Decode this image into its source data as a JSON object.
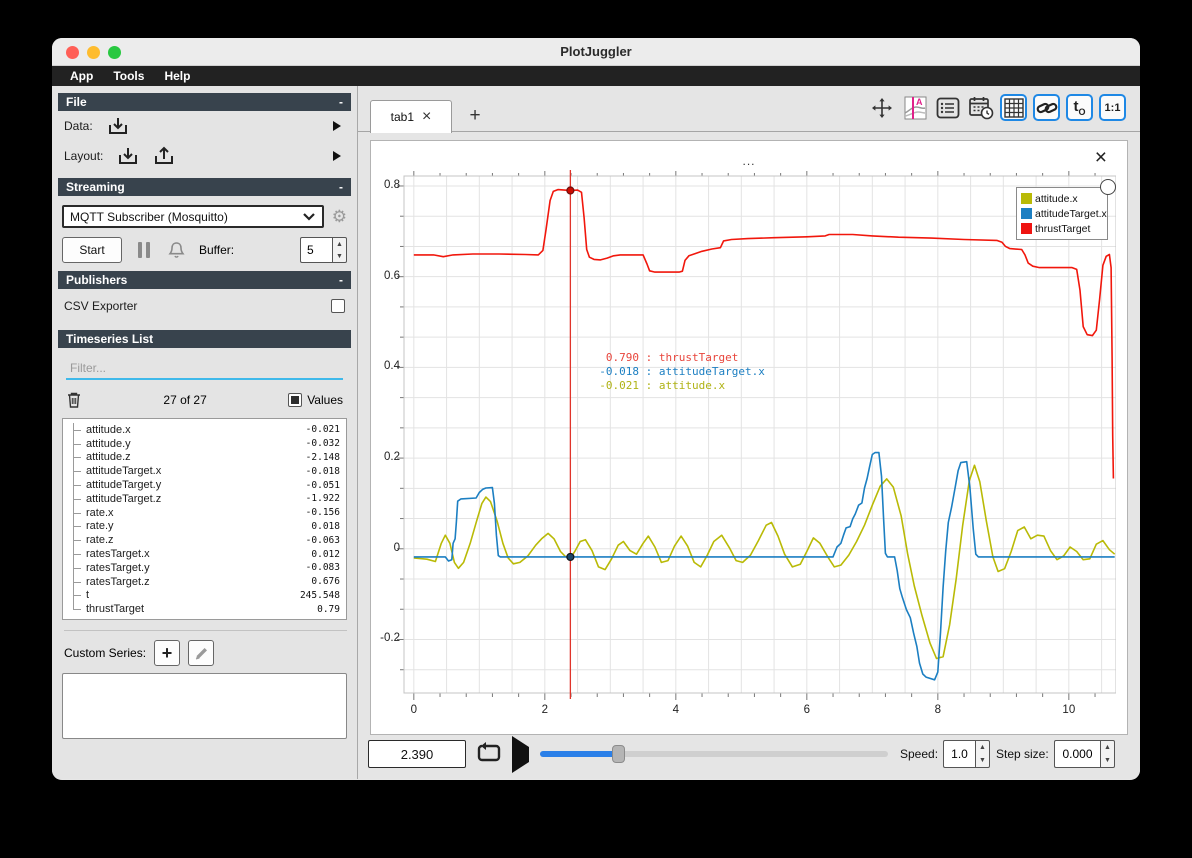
{
  "window": {
    "title": "PlotJuggler"
  },
  "menu": {
    "items": [
      "App",
      "Tools",
      "Help"
    ]
  },
  "ui": {
    "collapse_glyph": "-",
    "plus_glyph": "+",
    "close_glyph": "×"
  },
  "sidebar": {
    "file": {
      "title": "File",
      "data_label": "Data:",
      "layout_label": "Layout:"
    },
    "streaming": {
      "title": "Streaming",
      "source_selected": "MQTT Subscriber (Mosquitto)",
      "start_label": "Start",
      "buffer_label": "Buffer:",
      "buffer_value": "5"
    },
    "publishers": {
      "title": "Publishers",
      "csv_label": "CSV Exporter",
      "csv_checked": false
    },
    "timeseries": {
      "title": "Timeseries List",
      "filter_placeholder": "Filter...",
      "count_text": "27 of 27",
      "values_label": "Values",
      "items": [
        {
          "name": "attitude.x",
          "value": "-0.021"
        },
        {
          "name": "attitude.y",
          "value": "-0.032"
        },
        {
          "name": "attitude.z",
          "value": "-2.148"
        },
        {
          "name": "attitudeTarget.x",
          "value": "-0.018"
        },
        {
          "name": "attitudeTarget.y",
          "value": "-0.051"
        },
        {
          "name": "attitudeTarget.z",
          "value": "-1.922"
        },
        {
          "name": "rate.x",
          "value": "-0.156"
        },
        {
          "name": "rate.y",
          "value": "0.018"
        },
        {
          "name": "rate.z",
          "value": "-0.063"
        },
        {
          "name": "ratesTarget.x",
          "value": "0.012"
        },
        {
          "name": "ratesTarget.y",
          "value": "-0.083"
        },
        {
          "name": "ratesTarget.z",
          "value": "0.676"
        },
        {
          "name": "t",
          "value": "245.548"
        },
        {
          "name": "thrustTarget",
          "value": "0.79"
        }
      ]
    },
    "custom_series_label": "Custom Series:"
  },
  "tabs": {
    "active_label": "tab1"
  },
  "toolbar": {
    "icons": [
      "pan-zoom",
      "tracker-style",
      "plot-list",
      "datetime",
      "grid-layout",
      "link-axes",
      "time-offset",
      "ratio-1-1"
    ],
    "t0_label": "t",
    "t0_sub": "O",
    "ratio_label": "1:1"
  },
  "plot": {
    "title": "...",
    "legend": [
      {
        "label": "attitude.x",
        "color": "#b9ba06"
      },
      {
        "label": "attitudeTarget.x",
        "color": "#1c7fc2"
      },
      {
        "label": "thrustTarget",
        "color": "#ef1411"
      }
    ],
    "tracker_readout": [
      {
        "value": "0.790",
        "sep": " : ",
        "name": "thrustTarget",
        "color": "#e8453c"
      },
      {
        "value": "-0.018",
        "sep": " : ",
        "name": "attitudeTarget.x",
        "color": "#1c7fc2"
      },
      {
        "value": "-0.021",
        "sep": " : ",
        "name": "attitude.x",
        "color": "#b0b315"
      }
    ]
  },
  "playback": {
    "time_value": "2.390",
    "speed_label": "Speed:",
    "speed_value": "1.0",
    "step_label": "Step size:",
    "step_value": "0.000",
    "slider_fraction": 0.225
  },
  "chart_data": {
    "type": "line",
    "title": "...",
    "xlabel": "",
    "ylabel": "",
    "xlim": [
      -0.15,
      10.72
    ],
    "ylim": [
      -0.318,
      0.822
    ],
    "xticks": [
      {
        "v": 0,
        "label": "0"
      },
      {
        "v": 2,
        "label": "2"
      },
      {
        "v": 4,
        "label": "4"
      },
      {
        "v": 6,
        "label": "6"
      },
      {
        "v": 8,
        "label": "8"
      },
      {
        "v": 10,
        "label": "10"
      }
    ],
    "yticks": [
      {
        "v": 0.8,
        "label": "0.8"
      },
      {
        "v": 0.6,
        "label": "0.6"
      },
      {
        "v": 0.4,
        "label": "0.4"
      },
      {
        "v": 0.2,
        "label": "0.2"
      },
      {
        "v": 0,
        "label": "0"
      },
      {
        "v": -0.2,
        "label": "-0.2"
      }
    ],
    "x_minor_step": 0.4,
    "y_minor_step": 0.0666667,
    "x_grid_step": 0.5,
    "y_grid_step": 0.0666667,
    "grid": true,
    "legend_position": "top-right",
    "tracker": {
      "x": 2.39,
      "color": "#e0342a",
      "dots": [
        {
          "y": 0.79,
          "fill": "#cc0b00",
          "stroke": "#6e0e0e"
        },
        {
          "y": -0.018,
          "fill": "#1c4766",
          "stroke": "#10161c"
        }
      ]
    },
    "series": [
      {
        "name": "attitude.x",
        "color": "#b9ba06",
        "points": [
          [
            0,
            -0.02
          ],
          [
            0.2,
            -0.023
          ],
          [
            0.33,
            -0.028
          ],
          [
            0.42,
            0.012
          ],
          [
            0.48,
            0.03
          ],
          [
            0.55,
            0.012
          ],
          [
            0.62,
            -0.03
          ],
          [
            0.68,
            -0.043
          ],
          [
            0.76,
            -0.03
          ],
          [
            0.86,
            0.012
          ],
          [
            0.96,
            0.062
          ],
          [
            1.04,
            0.1
          ],
          [
            1.1,
            0.114
          ],
          [
            1.17,
            0.104
          ],
          [
            1.27,
            0.062
          ],
          [
            1.36,
            0.012
          ],
          [
            1.44,
            -0.02
          ],
          [
            1.52,
            -0.033
          ],
          [
            1.62,
            -0.03
          ],
          [
            1.74,
            -0.016
          ],
          [
            1.86,
            0.008
          ],
          [
            1.95,
            0.022
          ],
          [
            2.05,
            0.034
          ],
          [
            2.14,
            0.022
          ],
          [
            2.24,
            -0.006
          ],
          [
            2.32,
            -0.018
          ],
          [
            2.39,
            -0.021
          ],
          [
            2.46,
            -0.005
          ],
          [
            2.54,
            0.016
          ],
          [
            2.62,
            0.02
          ],
          [
            2.72,
            -0.004
          ],
          [
            2.82,
            -0.04
          ],
          [
            2.92,
            -0.046
          ],
          [
            3.02,
            -0.022
          ],
          [
            3.12,
            0.008
          ],
          [
            3.2,
            0.016
          ],
          [
            3.3,
            -0.004
          ],
          [
            3.4,
            -0.012
          ],
          [
            3.5,
            0.012
          ],
          [
            3.58,
            0.028
          ],
          [
            3.68,
            0.004
          ],
          [
            3.78,
            -0.03
          ],
          [
            3.88,
            -0.026
          ],
          [
            3.98,
            0.006
          ],
          [
            4.08,
            0.028
          ],
          [
            4.18,
            0.006
          ],
          [
            4.28,
            -0.03
          ],
          [
            4.38,
            -0.04
          ],
          [
            4.48,
            -0.014
          ],
          [
            4.58,
            0.016
          ],
          [
            4.7,
            0.03
          ],
          [
            4.82,
            0.002
          ],
          [
            4.92,
            -0.026
          ],
          [
            5.02,
            -0.03
          ],
          [
            5.14,
            -0.014
          ],
          [
            5.26,
            0.018
          ],
          [
            5.38,
            0.052
          ],
          [
            5.46,
            0.058
          ],
          [
            5.56,
            0.028
          ],
          [
            5.66,
            -0.012
          ],
          [
            5.78,
            -0.04
          ],
          [
            5.9,
            -0.034
          ],
          [
            6.0,
            -0.006
          ],
          [
            6.1,
            0.024
          ],
          [
            6.2,
            0.012
          ],
          [
            6.32,
            -0.018
          ],
          [
            6.42,
            -0.04
          ],
          [
            6.52,
            -0.036
          ],
          [
            6.64,
            -0.014
          ],
          [
            6.76,
            0.016
          ],
          [
            6.88,
            0.052
          ],
          [
            7.0,
            0.096
          ],
          [
            7.12,
            0.138
          ],
          [
            7.22,
            0.154
          ],
          [
            7.32,
            0.136
          ],
          [
            7.44,
            0.072
          ],
          [
            7.54,
            -0.012
          ],
          [
            7.64,
            -0.082
          ],
          [
            7.76,
            -0.148
          ],
          [
            7.88,
            -0.208
          ],
          [
            7.98,
            -0.242
          ],
          [
            8.08,
            -0.238
          ],
          [
            8.18,
            -0.168
          ],
          [
            8.28,
            -0.066
          ],
          [
            8.38,
            0.052
          ],
          [
            8.48,
            0.15
          ],
          [
            8.56,
            0.184
          ],
          [
            8.64,
            0.148
          ],
          [
            8.74,
            0.062
          ],
          [
            8.84,
            -0.018
          ],
          [
            8.92,
            -0.05
          ],
          [
            9.02,
            -0.044
          ],
          [
            9.12,
            -0.006
          ],
          [
            9.22,
            0.04
          ],
          [
            9.32,
            0.048
          ],
          [
            9.42,
            0.022
          ],
          [
            9.52,
            0.03
          ],
          [
            9.62,
            0.028
          ],
          [
            9.72,
            -0.004
          ],
          [
            9.82,
            -0.024
          ],
          [
            9.92,
            -0.016
          ],
          [
            10.02,
            0.004
          ],
          [
            10.12,
            -0.006
          ],
          [
            10.22,
            -0.024
          ],
          [
            10.32,
            -0.022
          ],
          [
            10.42,
            0.01
          ],
          [
            10.52,
            0.018
          ],
          [
            10.62,
            -0.002
          ],
          [
            10.7,
            -0.012
          ]
        ]
      },
      {
        "name": "attitudeTarget.x",
        "color": "#1c7fc2",
        "points": [
          [
            0,
            -0.018
          ],
          [
            0.48,
            -0.018
          ],
          [
            0.53,
            -0.027
          ],
          [
            0.58,
            -0.024
          ],
          [
            0.6,
            0.012
          ],
          [
            0.63,
            0.022
          ],
          [
            0.65,
            0.06
          ],
          [
            0.67,
            0.105
          ],
          [
            0.72,
            0.11
          ],
          [
            0.95,
            0.112
          ],
          [
            1.0,
            0.124
          ],
          [
            1.05,
            0.131
          ],
          [
            1.1,
            0.134
          ],
          [
            1.2,
            0.135
          ],
          [
            1.23,
            0.1
          ],
          [
            1.26,
            0.03
          ],
          [
            1.29,
            -0.015
          ],
          [
            1.32,
            -0.018
          ],
          [
            6.4,
            -0.018
          ],
          [
            6.46,
            0.004
          ],
          [
            6.52,
            0.012
          ],
          [
            6.56,
            0.03
          ],
          [
            6.6,
            0.046
          ],
          [
            6.66,
            0.049
          ],
          [
            6.7,
            0.066
          ],
          [
            6.74,
            0.077
          ],
          [
            6.79,
            0.096
          ],
          [
            6.84,
            0.101
          ],
          [
            6.88,
            0.134
          ],
          [
            6.92,
            0.155
          ],
          [
            6.96,
            0.182
          ],
          [
            7.0,
            0.208
          ],
          [
            7.04,
            0.212
          ],
          [
            7.1,
            0.212
          ],
          [
            7.14,
            0.16
          ],
          [
            7.17,
            0.07
          ],
          [
            7.2,
            -0.01
          ],
          [
            7.23,
            -0.018
          ],
          [
            7.34,
            -0.018
          ],
          [
            7.38,
            -0.048
          ],
          [
            7.42,
            -0.088
          ],
          [
            7.46,
            -0.108
          ],
          [
            7.52,
            -0.134
          ],
          [
            7.58,
            -0.152
          ],
          [
            7.63,
            -0.186
          ],
          [
            7.68,
            -0.216
          ],
          [
            7.72,
            -0.252
          ],
          [
            7.77,
            -0.276
          ],
          [
            7.82,
            -0.283
          ],
          [
            7.95,
            -0.289
          ],
          [
            8.0,
            -0.272
          ],
          [
            8.04,
            -0.185
          ],
          [
            8.08,
            -0.085
          ],
          [
            8.12,
            -0.005
          ],
          [
            8.16,
            0.058
          ],
          [
            8.21,
            0.092
          ],
          [
            8.26,
            0.132
          ],
          [
            8.31,
            0.172
          ],
          [
            8.35,
            0.19
          ],
          [
            8.44,
            0.192
          ],
          [
            8.49,
            0.135
          ],
          [
            8.54,
            0.045
          ],
          [
            8.58,
            -0.012
          ],
          [
            8.62,
            -0.018
          ],
          [
            10.7,
            -0.018
          ]
        ]
      },
      {
        "name": "thrustTarget",
        "color": "#f1170c",
        "points": [
          [
            0,
            0.648
          ],
          [
            0.3,
            0.648
          ],
          [
            0.45,
            0.644
          ],
          [
            0.6,
            0.648
          ],
          [
            0.9,
            0.65
          ],
          [
            1.3,
            0.65
          ],
          [
            1.7,
            0.649
          ],
          [
            1.9,
            0.648
          ],
          [
            1.97,
            0.658
          ],
          [
            2.02,
            0.705
          ],
          [
            2.08,
            0.768
          ],
          [
            2.13,
            0.788
          ],
          [
            2.2,
            0.792
          ],
          [
            2.3,
            0.791
          ],
          [
            2.39,
            0.79
          ],
          [
            2.5,
            0.791
          ],
          [
            2.56,
            0.786
          ],
          [
            2.6,
            0.73
          ],
          [
            2.64,
            0.66
          ],
          [
            2.68,
            0.643
          ],
          [
            2.75,
            0.638
          ],
          [
            2.85,
            0.637
          ],
          [
            2.95,
            0.641
          ],
          [
            3.05,
            0.646
          ],
          [
            3.15,
            0.648
          ],
          [
            3.5,
            0.648
          ],
          [
            3.56,
            0.628
          ],
          [
            3.6,
            0.613
          ],
          [
            3.68,
            0.61
          ],
          [
            4.05,
            0.61
          ],
          [
            4.1,
            0.612
          ],
          [
            4.14,
            0.636
          ],
          [
            4.2,
            0.646
          ],
          [
            4.3,
            0.651
          ],
          [
            4.4,
            0.656
          ],
          [
            4.55,
            0.661
          ],
          [
            4.68,
            0.664
          ],
          [
            4.73,
            0.679
          ],
          [
            4.85,
            0.682
          ],
          [
            5.1,
            0.684
          ],
          [
            5.5,
            0.686
          ],
          [
            6.0,
            0.688
          ],
          [
            6.28,
            0.69
          ],
          [
            6.34,
            0.693
          ],
          [
            6.7,
            0.693
          ],
          [
            7.0,
            0.69
          ],
          [
            7.4,
            0.687
          ],
          [
            7.9,
            0.685
          ],
          [
            8.4,
            0.682
          ],
          [
            8.9,
            0.68
          ],
          [
            8.98,
            0.676
          ],
          [
            9.03,
            0.667
          ],
          [
            9.1,
            0.662
          ],
          [
            9.28,
            0.66
          ],
          [
            9.33,
            0.648
          ],
          [
            9.38,
            0.63
          ],
          [
            9.45,
            0.623
          ],
          [
            9.55,
            0.62
          ],
          [
            10.05,
            0.62
          ],
          [
            10.12,
            0.616
          ],
          [
            10.17,
            0.57
          ],
          [
            10.22,
            0.49
          ],
          [
            10.28,
            0.472
          ],
          [
            10.36,
            0.47
          ],
          [
            10.42,
            0.482
          ],
          [
            10.47,
            0.55
          ],
          [
            10.52,
            0.625
          ],
          [
            10.57,
            0.645
          ],
          [
            10.62,
            0.649
          ],
          [
            10.645,
            0.62
          ],
          [
            10.66,
            0.42
          ],
          [
            10.67,
            0.25
          ],
          [
            10.68,
            0.155
          ]
        ]
      }
    ]
  }
}
